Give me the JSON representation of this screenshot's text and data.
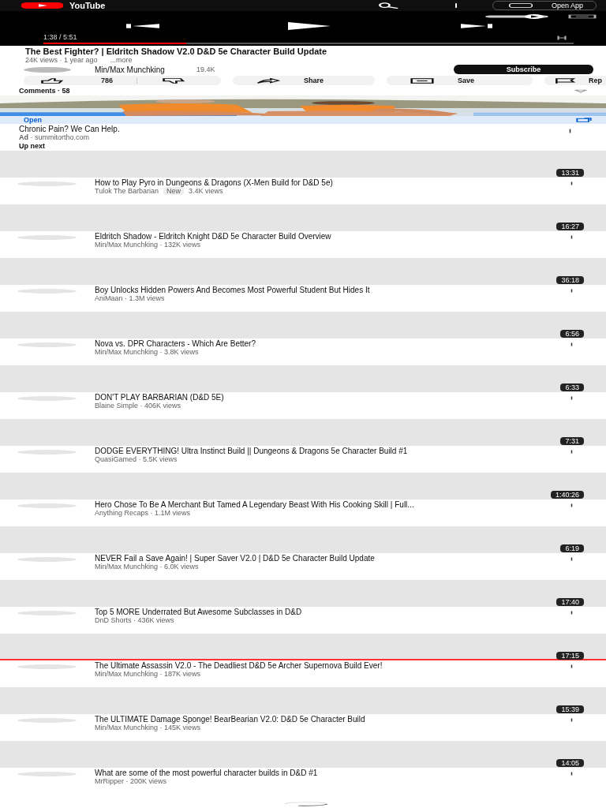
{
  "top_bar": {
    "logo": "YouTube",
    "open_app": "Open App"
  },
  "player": {
    "time": "1:38 / 5:51",
    "level": 0.27
  },
  "video": {
    "title": "The Best Fighter? | Eldritch Shadow V2.0 D&D 5e Character Build Update",
    "meta": "24K views · 1 year ago",
    "more": "...more",
    "channel": "Min/Max Munchking",
    "subscribers": "19.4K",
    "subscribe": "Subscribe",
    "likes": "786",
    "share": "Share",
    "save": "Save",
    "report": "Rep"
  },
  "comments": {
    "label": "Comments · 58"
  },
  "ad": {
    "open": "Open",
    "title": "Chronic Pain? We Can Help.",
    "source": "**Ad** · summitortho.com"
  },
  "up_next": "Up next",
  "videos": [
    {
      "duration": "13:31",
      "title": "How to Play Pyro in Dungeons & Dragons (X-Men Build for D&D 5e)",
      "meta": "Tulok The Barbarian",
      "badge": "New",
      "views": "3.4K views"
    },
    {
      "duration": "16:27",
      "title": "Eldritch Shadow - Eldritch Knight D&D 5e Character Build Overview",
      "meta": "Min/Max Munchking · 132K views"
    },
    {
      "duration": "36:18",
      "title": "Boy Unlocks Hidden Powers And Becomes Most Powerful Student But Hides It",
      "meta": "AniMaan · 1.3M views"
    },
    {
      "duration": "6:56",
      "title": "Nova vs. DPR Characters - Which Are Better?",
      "meta": "Min/Max Munchking · 3.8K views"
    },
    {
      "duration": "6:33",
      "title": "DON'T PLAY BARBARIAN (D&D 5E)",
      "meta": "Blaine Simple · 406K views"
    },
    {
      "duration": "7:31",
      "title": "DODGE EVERYTHING! Ultra Instinct Build || Dungeons & Dragons 5e Character Build #1",
      "meta": "QuasiGamed · 5.5K views"
    },
    {
      "duration": "1:40:26",
      "title": "Hero Chose To Be A Merchant But Tamed A Legendary Beast With His Cooking Skill | Full...",
      "meta": "Anything Recaps · 1.1M views"
    },
    {
      "duration": "6:19",
      "title": "NEVER Fail a Save Again! | Super Saver V2.0 | D&D 5e Character Build Update",
      "meta": "Min/Max Munchking · 6.0K views"
    },
    {
      "duration": "17:40",
      "title": "Top 5 MORE Underrated But Awesome Subclasses in D&D",
      "meta": "DnD Shorts · 436K views"
    },
    {
      "duration": "17:15",
      "title": "The Ultimate Assassin V2.0 - The Deadliest D&D 5e Archer Supernova Build Ever!",
      "meta": "Min/Max Munchking · 187K views",
      "level": 1
    },
    {
      "duration": "15:39",
      "title": "The ULTIMATE Damage Sponge! BearBearian V2.0: D&D 5e Character Build",
      "meta": "Min/Max Munchking · 145K views"
    },
    {
      "duration": "14:05",
      "title": "What are some of the most powerful character builds in D&D #1",
      "meta": "MrRipper · 200K views"
    }
  ]
}
